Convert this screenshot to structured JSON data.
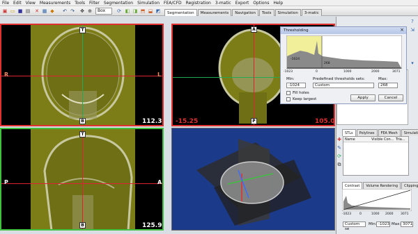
{
  "menu": [
    "File",
    "Edit",
    "View",
    "Measurements",
    "Tools",
    "Filter",
    "Segmentation",
    "Simulation",
    "FEA/CFD",
    "Registration",
    "3-matic",
    "Export",
    "Options",
    "Help"
  ],
  "toolbar": {
    "view_select": "Box"
  },
  "tabs": [
    "Segmentation",
    "Measurements",
    "Navigation",
    "Tools",
    "Simulation",
    "3-matic"
  ],
  "viewports": {
    "coronal": {
      "top": "T",
      "bottom": "B",
      "left": "R",
      "right": "L",
      "value": "112.30"
    },
    "axial": {
      "top": "A",
      "bottom": "P",
      "left": "-15.25",
      "right": "105.00"
    },
    "sagittal": {
      "top": "T",
      "bottom": "B",
      "left": "P",
      "right": "A",
      "value": "125.98"
    }
  },
  "threshold_dialog": {
    "title": "Thresholding",
    "hist_min_label": "-1024",
    "hist_max_label": "268",
    "ticks": [
      "-1023",
      "0",
      "1000",
      "2000",
      "3071"
    ],
    "min_label": "Min:",
    "min_value": "-1024",
    "predefined_label": "Predefined thresholds sets:",
    "predefined_value": "Custom",
    "max_label": "Max:",
    "max_value": "268",
    "fill_holes": "Fill holes",
    "keep_largest": "Keep largest",
    "apply": "Apply",
    "cancel": "Cancel"
  },
  "right_panel": {
    "tabs": [
      "STLs",
      "Polylines",
      "FEA Mesh",
      "Simulation O..."
    ],
    "columns": [
      "Name",
      "Visible",
      "Con...",
      "Tria..."
    ],
    "bottom_tabs": [
      "Contrast",
      "Volume Rendering",
      "Clipping"
    ],
    "ticks": [
      "-1023",
      "0",
      "1000",
      "2000",
      "3071"
    ],
    "preset": "Custom se",
    "min_label": "Min:",
    "min_value": "-1023",
    "max_label": "Max:",
    "max_value": "3071"
  },
  "colors": {
    "mask_yellow": "#8a8a14",
    "border_red": "#e03030",
    "border_green": "#40c040",
    "view3d_bg": "#1b3a8a"
  }
}
